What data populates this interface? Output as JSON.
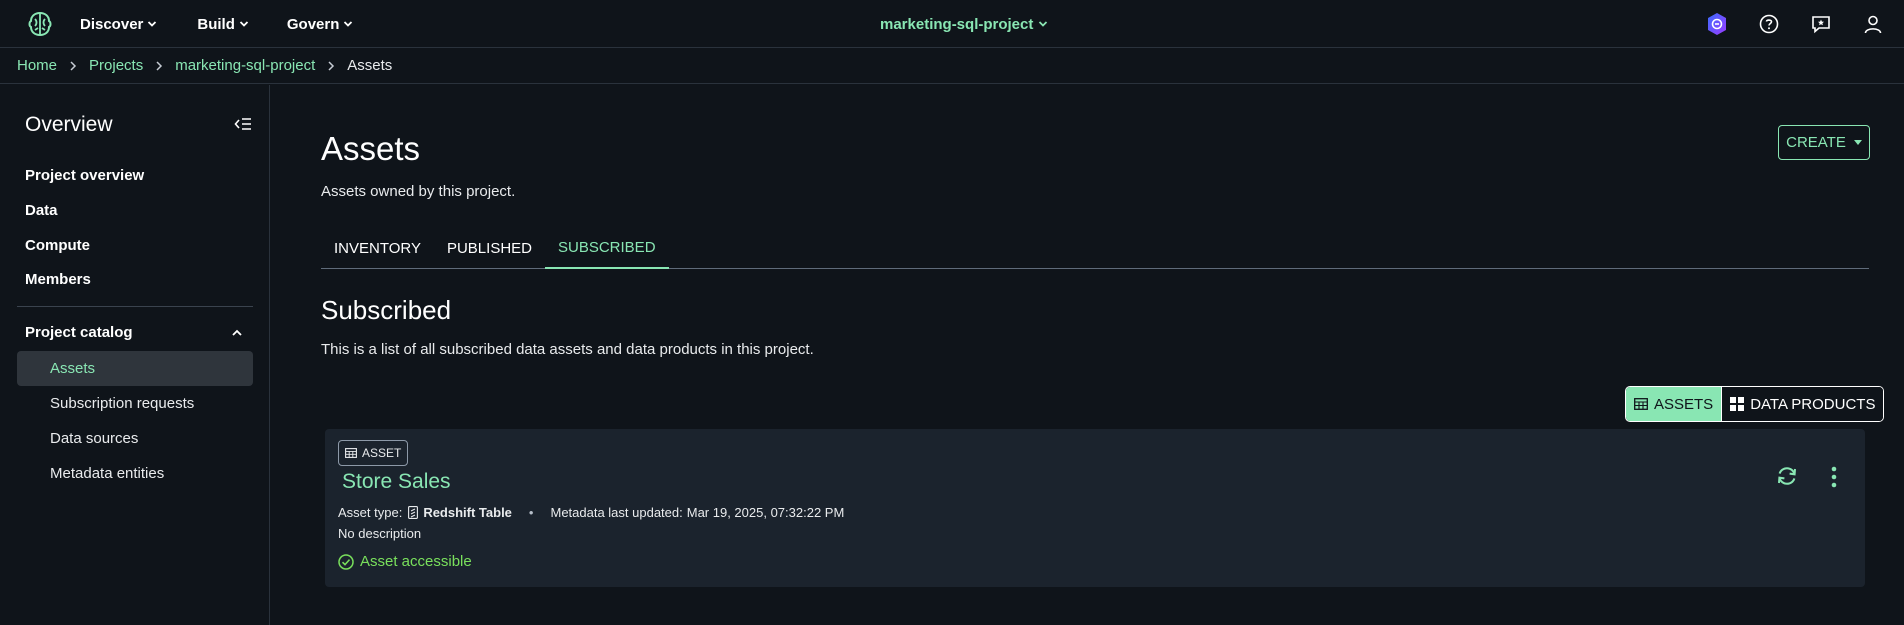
{
  "topbar": {
    "nav": [
      {
        "label": "Discover",
        "icon": "chevron-down-icon"
      },
      {
        "label": "Build",
        "icon": "chevron-down-icon"
      },
      {
        "label": "Govern",
        "icon": "chevron-down-icon"
      }
    ],
    "project_switch": "marketing-sql-project",
    "icons": [
      "shield-hexagon-icon",
      "help-icon",
      "feedback-icon",
      "user-icon"
    ]
  },
  "breadcrumb": {
    "items": [
      "Home",
      "Projects",
      "marketing-sql-project",
      "Assets"
    ]
  },
  "sidebar": {
    "title": "Overview",
    "items": [
      "Project overview",
      "Data",
      "Compute",
      "Members"
    ],
    "section": {
      "label": "Project catalog",
      "items": [
        "Assets",
        "Subscription requests",
        "Data sources",
        "Metadata entities"
      ],
      "active_index": 0
    }
  },
  "main": {
    "title": "Assets",
    "description": "Assets owned by this project.",
    "create_label": "CREATE",
    "tabs": [
      "INVENTORY",
      "PUBLISHED",
      "SUBSCRIBED"
    ],
    "active_tab": 2,
    "section_title": "Subscribed",
    "section_desc": "This is a list of all subscribed data assets and data products in this project.",
    "toggle": {
      "assets": "ASSETS",
      "data_products": "DATA PRODUCTS",
      "active": "ASSETS"
    },
    "card": {
      "badge": "ASSET",
      "title": "Store Sales",
      "asset_type_label": "Asset type:",
      "asset_type": "Redshift Table",
      "metadata_label": "Metadata last updated:",
      "metadata_value": "Mar 19, 2025, 07:32:22 PM",
      "description": "No description",
      "status": "Asset accessible"
    }
  },
  "colors": {
    "accent": "#89e6b3",
    "background": "#0f141a",
    "card": "#1b232d",
    "success": "#79e05c"
  }
}
